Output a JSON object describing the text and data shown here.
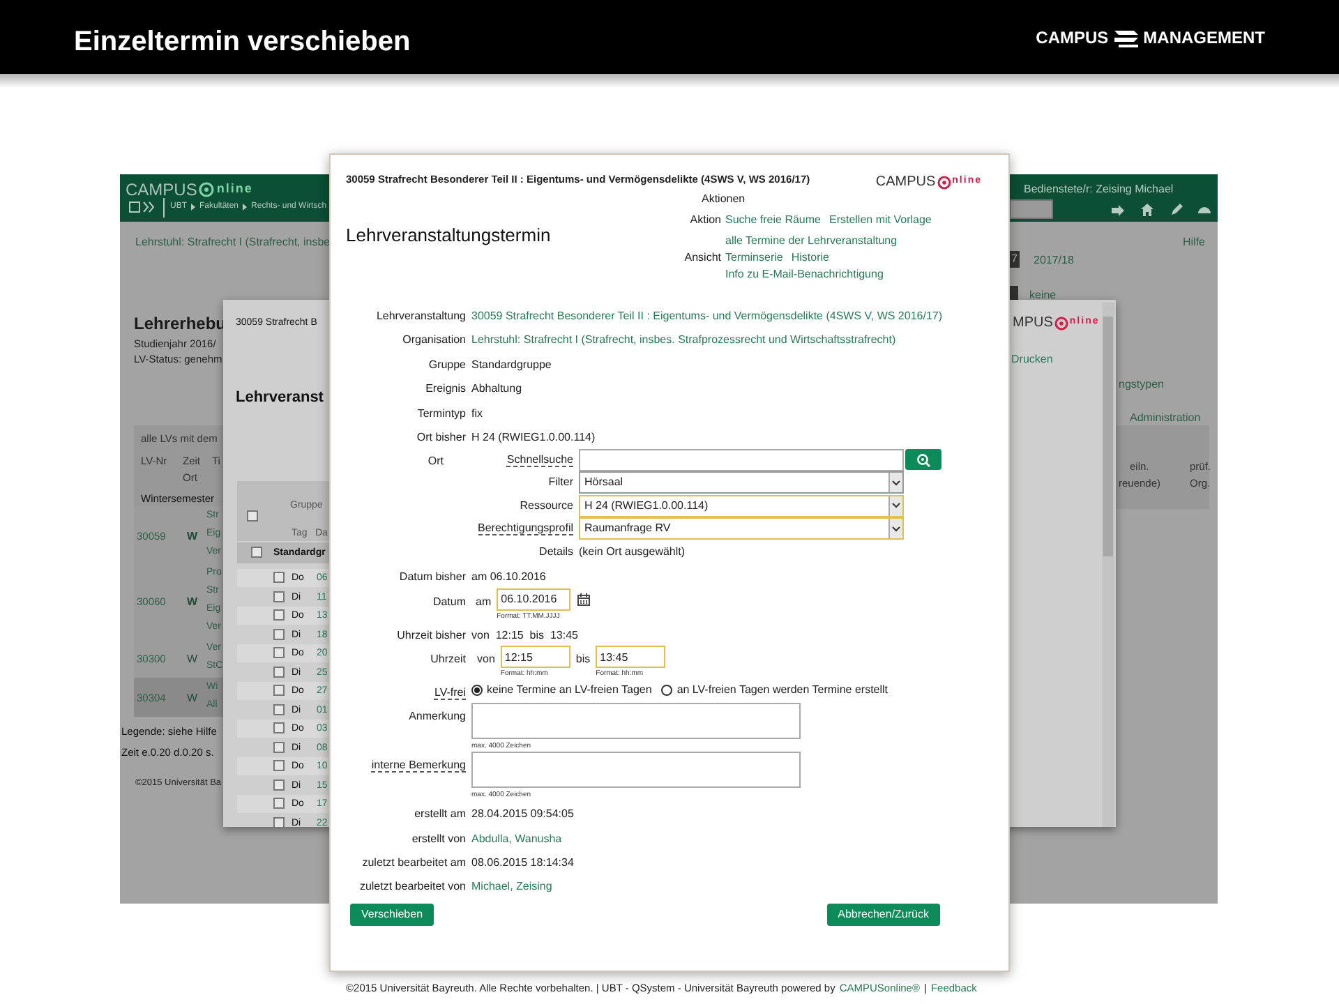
{
  "slide": {
    "title": "Einzeltermin verschieben",
    "logo_left": "CAMPUS",
    "logo_right": "MANAGEMENT"
  },
  "back_window": {
    "logo_word": "CAMPUS",
    "logo_suffix": "nline",
    "user": "Bedienstete/r: Zeising Michael",
    "breadcrumb": [
      "UBT",
      "Fakultäten",
      "Rechts- und Wirtsch"
    ],
    "org_link": "Lehrstuhl: Strafrecht I (Strafrecht, insbe",
    "help_link": "Hilfe",
    "year_badge": "7",
    "year": "2017/18",
    "status": "keine",
    "heading": "Lehrerhebu",
    "info_lines": [
      "Studienjahr 2016/",
      "LV-Status: genehm"
    ],
    "right_links": [
      "ngstypen",
      "Administration"
    ],
    "table": {
      "caption": "alle LVs mit dem",
      "columns": [
        "LV-Nr",
        "Zeit",
        "Ti"
      ],
      "subcolumn": "Ort",
      "right_columns": [
        "eiln.",
        "prüf."
      ],
      "right_subcolumns": [
        "reuende)",
        "Org."
      ],
      "section": "Wintersemester",
      "rows": [
        {
          "number": "30059",
          "term": "W",
          "bold": true,
          "highlighted": false,
          "title_lines": [
            "Str",
            "Eig",
            "Ver"
          ]
        },
        {
          "number": "30060",
          "term": "W",
          "bold": true,
          "highlighted": false,
          "title_lines": [
            "Pro",
            "Str",
            "Eig",
            "Ver"
          ]
        },
        {
          "number": "30300",
          "term": "W",
          "bold": false,
          "highlighted": false,
          "title_lines": [
            "Ver",
            "StC"
          ]
        },
        {
          "number": "30304",
          "term": "W",
          "bold": false,
          "highlighted": true,
          "title_lines": [
            "Wi",
            "All"
          ]
        }
      ]
    },
    "legend": "Legende: siehe Hilfe",
    "timing": "Zeit e.0.20 d.0.20 s.",
    "copyright": "©2015 Universität Ba"
  },
  "middle_window": {
    "header": "30059 Strafrecht B",
    "heading": "Lehrveranst",
    "logo_word": "MPUS",
    "logo_suffix": "nline",
    "print_link": "Drucken",
    "header_checked": false,
    "columns": [
      "Gruppe",
      "Tag",
      "Da"
    ],
    "group": {
      "label": "Standardgr",
      "checked": false
    },
    "rows": [
      {
        "day": "Do",
        "date": "06",
        "checked": false
      },
      {
        "day": "Di",
        "date": "11",
        "checked": false
      },
      {
        "day": "Do",
        "date": "13",
        "checked": false
      },
      {
        "day": "Di",
        "date": "18",
        "checked": false
      },
      {
        "day": "Do",
        "date": "20",
        "checked": false
      },
      {
        "day": "Di",
        "date": "25",
        "checked": false
      },
      {
        "day": "Do",
        "date": "27",
        "checked": false
      },
      {
        "day": "Di",
        "date": "01",
        "checked": false
      },
      {
        "day": "Do",
        "date": "03",
        "checked": false
      },
      {
        "day": "Di",
        "date": "08",
        "checked": false
      },
      {
        "day": "Do",
        "date": "10",
        "checked": false
      },
      {
        "day": "Di",
        "date": "15",
        "checked": false
      },
      {
        "day": "Do",
        "date": "17",
        "checked": false
      },
      {
        "day": "Di",
        "date": "22",
        "checked": false
      }
    ]
  },
  "dialog": {
    "header": "30059 Strafrecht Besonderer Teil II : Eigentums- und Vermögensdelikte (4SWS V, WS 2016/17)",
    "logo_word": "CAMPUS",
    "logo_suffix": "nline",
    "heading": "Lehrveranstaltungstermin",
    "actions": {
      "title": "Aktionen",
      "groups": [
        {
          "label": "Aktion",
          "links": [
            "Suche freie Räume",
            "Erstellen mit Vorlage"
          ]
        },
        {
          "label": "Ansicht",
          "links": [
            "alle Termine der Lehrveranstaltung",
            "Terminserie",
            "Historie",
            "Info zu E-Mail-Benachrichtigung"
          ]
        }
      ]
    },
    "fields": [
      {
        "kind": "link",
        "label": "Lehrveranstaltung",
        "help": false,
        "value": "30059 Strafrecht Besonderer Teil II : Eigentums- und Vermögensdelikte (4SWS V, WS 2016/17)"
      },
      {
        "kind": "link",
        "label": "Organisation",
        "help": false,
        "value": "Lehrstuhl: Strafrecht I (Strafrecht, insbes. Strafprozessrecht und Wirtschaftsstrafrecht)"
      },
      {
        "kind": "text",
        "label": "Gruppe",
        "help": false,
        "value": "Standardgruppe"
      },
      {
        "kind": "text",
        "label": "Ereignis",
        "help": false,
        "value": "Abhaltung"
      },
      {
        "kind": "text",
        "label": "Termintyp",
        "help": false,
        "value": "fix"
      },
      {
        "kind": "text",
        "label": "Ort bisher",
        "help": false,
        "value": "H 24 (RWIEG1.0.00.114)"
      },
      {
        "kind": "location",
        "label": "Ort",
        "help": false,
        "search_label": "Schnellsuche",
        "search_help": true,
        "selects": [
          {
            "label": "Filter",
            "value": "Hörsaal",
            "help": false,
            "highlighted": false
          },
          {
            "label": "Ressource",
            "value": "H 24 (RWIEG1.0.00.114)",
            "help": false,
            "highlighted": true
          },
          {
            "label": "Berechtigungsprofil",
            "value": "Raumanfrage RV",
            "help": true,
            "highlighted": true
          }
        ],
        "details_label": "Details",
        "details": "(kein Ort ausgewählt)"
      },
      {
        "kind": "text",
        "label": "Datum bisher",
        "help": false,
        "value": "am 06.10.2016"
      },
      {
        "kind": "date",
        "label": "Datum",
        "help": false,
        "prefix": "am",
        "value": "06.10.2016",
        "hint": "Format: TT.MM.JJJJ"
      },
      {
        "kind": "text",
        "label": "Uhrzeit bisher",
        "help": false,
        "value": "von  12:15  bis  13:45"
      },
      {
        "kind": "time",
        "label": "Uhrzeit",
        "help": false,
        "from_label": "von",
        "from": "12:15",
        "from_hint": "Format: hh:mm",
        "to_label": "bis",
        "to": "13:45",
        "to_hint": "Format: hh:mm"
      },
      {
        "kind": "radio",
        "label": "LV-frei",
        "help": true,
        "options": [
          {
            "label": "keine Termine an LV-freien Tagen",
            "selected": true
          },
          {
            "label": "an LV-freien Tagen werden Termine erstellt",
            "selected": false
          }
        ]
      },
      {
        "kind": "textarea",
        "label": "Anmerkung",
        "help": false,
        "hint": "max. 4000 Zeichen"
      },
      {
        "kind": "textarea",
        "label": "interne Bemerkung",
        "help": true,
        "hint": "max. 4000 Zeichen"
      },
      {
        "kind": "text",
        "label": "erstellt am",
        "help": false,
        "value": "28.04.2015 09:54:05"
      },
      {
        "kind": "link",
        "label": "erstellt von",
        "help": false,
        "value": "Abdulla, Wanusha"
      },
      {
        "kind": "text",
        "label": "zuletzt bearbeitet am",
        "help": false,
        "value": "08.06.2015 18:14:34"
      },
      {
        "kind": "link",
        "label": "zuletzt bearbeitet von",
        "help": false,
        "value": "Michael, Zeising"
      }
    ],
    "buttons": [
      "Verschieben",
      "Abbrechen/Zurück"
    ],
    "footer": {
      "text": "©2015 Universität Bayreuth. Alle Rechte vorbehalten. | UBT - QSystem - Universität Bayreuth powered by",
      "link": "CAMPUSonline®",
      "separator": "|",
      "feedback": "Feedback"
    }
  }
}
